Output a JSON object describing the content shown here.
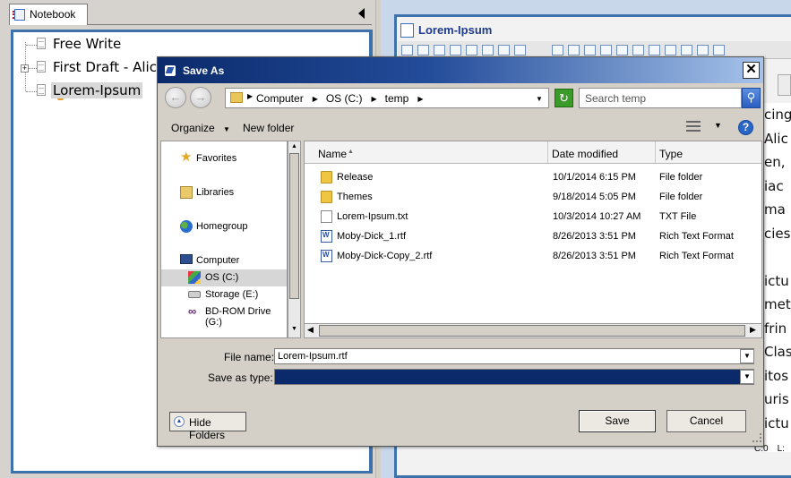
{
  "notebook": {
    "tab_label": "Notebook",
    "tree": [
      {
        "label": "Free Write"
      },
      {
        "label": "First Draft - Alic"
      },
      {
        "label": "Lorem-Ipsum",
        "selected": true
      }
    ]
  },
  "editor": {
    "title": "Lorem-Ipsum",
    "text_fragments": [
      "cing",
      "Alic",
      "en,",
      "iac",
      "ma",
      "cies",
      "",
      "ictu",
      "met",
      "frin",
      "Clas",
      "itos",
      "uris",
      "ictu"
    ],
    "status": [
      "C:0",
      "L:"
    ]
  },
  "dialog": {
    "title": "Save As",
    "close_label": "✕",
    "address": {
      "crumbs": [
        "Computer",
        "OS (C:)",
        "temp"
      ]
    },
    "search_placeholder": "Search temp",
    "toolbar": {
      "organize": "Organize",
      "new_folder": "New folder"
    },
    "nav_items": [
      {
        "label": "Favorites",
        "icon": "star-icon"
      },
      {
        "label": "Libraries",
        "icon": "library-icon"
      },
      {
        "label": "Homegroup",
        "icon": "homegroup-icon"
      },
      {
        "label": "Computer",
        "icon": "computer-icon"
      },
      {
        "label": "OS (C:)",
        "icon": "drive-icon",
        "selected": true
      },
      {
        "label": "Storage (E:)",
        "icon": "drive-icon"
      },
      {
        "label": "BD-ROM Drive (G:)",
        "icon": "visual-studio-icon"
      }
    ],
    "columns": [
      "Name",
      "Date modified",
      "Type"
    ],
    "files": [
      {
        "name": "Release",
        "date": "10/1/2014 6:15 PM",
        "type": "File folder",
        "icon": "folder-icon"
      },
      {
        "name": "Themes",
        "date": "9/18/2014 5:05 PM",
        "type": "File folder",
        "icon": "folder-icon"
      },
      {
        "name": "Lorem-Ipsum.txt",
        "date": "10/3/2014 10:27 AM",
        "type": "TXT File",
        "icon": "text-file-icon"
      },
      {
        "name": "Moby-Dick_1.rtf",
        "date": "8/26/2013 3:51 PM",
        "type": "Rich Text Format",
        "icon": "rtf-file-icon"
      },
      {
        "name": "Moby-Dick-Copy_2.rtf",
        "date": "8/26/2013 3:51 PM",
        "type": "Rich Text Format",
        "icon": "rtf-file-icon"
      }
    ],
    "file_name_label": "File name:",
    "file_name_value": "Lorem-Ipsum.rtf",
    "save_type_label": "Save as type:",
    "save_type_value": "",
    "hide_folders": "Hide Folders",
    "save": "Save",
    "cancel": "Cancel"
  },
  "colors": {
    "title_bar": "#0b2a6b",
    "accent": "#3f72ab",
    "selection": "#d6d6d6"
  }
}
